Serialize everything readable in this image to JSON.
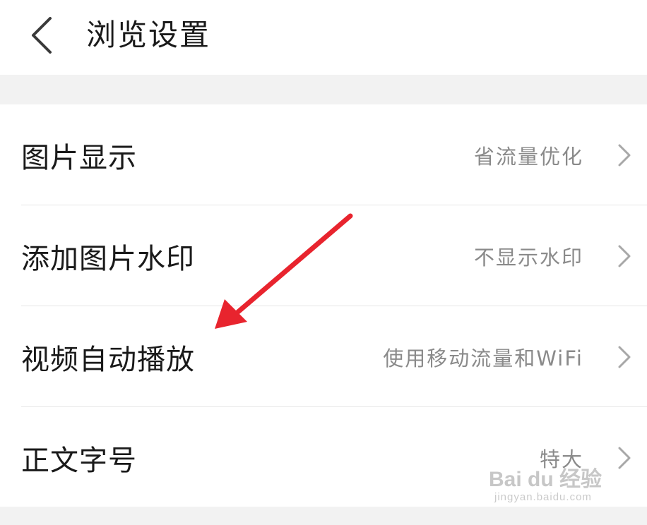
{
  "header": {
    "title": "浏览设置",
    "back_icon": "chevron-left-icon"
  },
  "settings": [
    {
      "label": "图片显示",
      "value": "省流量优化"
    },
    {
      "label": "添加图片水印",
      "value": "不显示水印"
    },
    {
      "label": "视频自动播放",
      "value": "使用移动流量和WiFi"
    },
    {
      "label": "正文字号",
      "value": "特大"
    }
  ],
  "annotation": {
    "icon": "red-arrow-icon",
    "color": "#e8242e"
  },
  "watermark": {
    "logo_text": "Bai du 经验",
    "url": "jingyan.baidu.com"
  },
  "colors": {
    "text_primary": "#1a1a1a",
    "text_secondary": "#8a8a8a",
    "band": "#f2f2f2",
    "chevron": "#a8a8a8"
  }
}
